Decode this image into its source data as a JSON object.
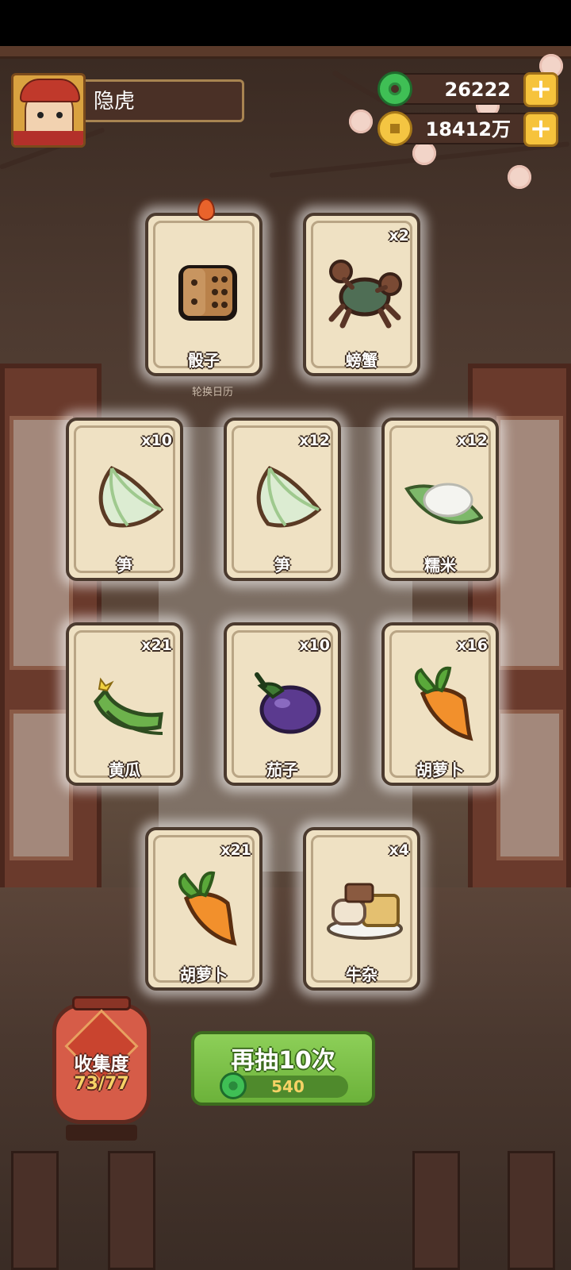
{
  "player": {
    "name": "隐虎"
  },
  "currency": {
    "jade": "26222",
    "coins": "18412万"
  },
  "hint_text": "轮换日历",
  "cards": [
    {
      "name": "骰子",
      "count": "",
      "icon": "dice-icon"
    },
    {
      "name": "螃蟹",
      "count": "x2",
      "icon": "crab-icon"
    },
    {
      "name": "笋",
      "count": "x10",
      "icon": "bamboo-shoot-icon"
    },
    {
      "name": "笋",
      "count": "x12",
      "icon": "bamboo-shoot-icon"
    },
    {
      "name": "糯米",
      "count": "x12",
      "icon": "sticky-rice-icon"
    },
    {
      "name": "黄瓜",
      "count": "x21",
      "icon": "cucumber-icon"
    },
    {
      "name": "茄子",
      "count": "x10",
      "icon": "eggplant-icon"
    },
    {
      "name": "胡萝卜",
      "count": "x16",
      "icon": "carrot-icon"
    },
    {
      "name": "胡萝卜",
      "count": "x21",
      "icon": "carrot-icon"
    },
    {
      "name": "牛杂",
      "count": "x4",
      "icon": "beef-offal-icon"
    }
  ],
  "collection": {
    "title": "收集度",
    "value": "73/77"
  },
  "draw_button": {
    "label": "再抽10次",
    "cost": "540"
  },
  "colors": {
    "card_bg": "#efe1c3",
    "button_green": "#6cb23a",
    "lantern_red": "#d65c48",
    "gold": "#f6c33c"
  }
}
